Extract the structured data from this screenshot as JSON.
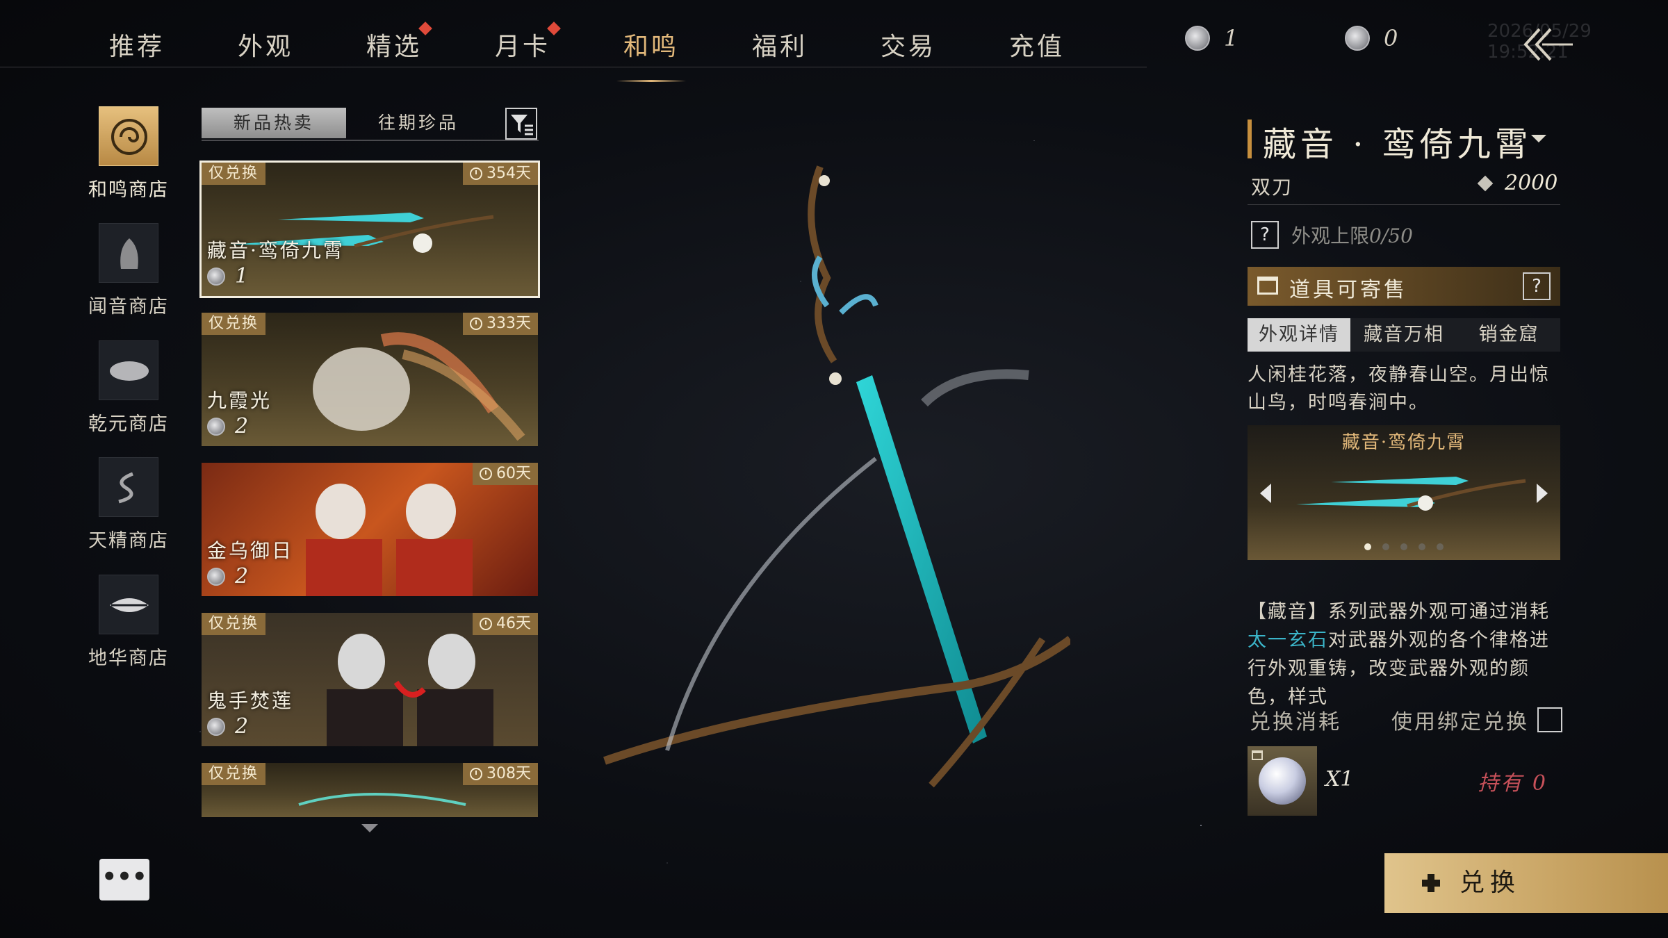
{
  "nav": {
    "tabs": [
      {
        "label": "推荐",
        "dot": false
      },
      {
        "label": "外观",
        "dot": false
      },
      {
        "label": "精选",
        "dot": true
      },
      {
        "label": "月卡",
        "dot": true
      },
      {
        "label": "和鸣",
        "dot": false,
        "active": true
      },
      {
        "label": "福利",
        "dot": false
      },
      {
        "label": "交易",
        "dot": false
      },
      {
        "label": "充值",
        "dot": false
      }
    ],
    "currency_a": "1",
    "currency_b": "0",
    "timestamp": "2026/05/29 19:52:21",
    "back_icon": "double-chevron-left-icon"
  },
  "shops": [
    {
      "label": "和鸣商店",
      "active": true
    },
    {
      "label": "闻音商店",
      "active": false
    },
    {
      "label": "乾元商店",
      "active": false
    },
    {
      "label": "天精商店",
      "active": false
    },
    {
      "label": "地华商店",
      "active": false
    }
  ],
  "list": {
    "subtabs": [
      "新品热卖",
      "往期珍品"
    ],
    "active_subtab": 0,
    "items": [
      {
        "tag": "仅兑换",
        "days": "354天",
        "name": "藏音·鸾倚九霄",
        "price": "1",
        "selected": true
      },
      {
        "tag": "仅兑换",
        "days": "333天",
        "name": "九霞光",
        "price": "2",
        "selected": false
      },
      {
        "tag": "",
        "days": "60天",
        "name": "金乌御日",
        "price": "2",
        "selected": false
      },
      {
        "tag": "仅兑换",
        "days": "46天",
        "name": "鬼手焚莲",
        "price": "2",
        "selected": false
      },
      {
        "tag": "仅兑换",
        "days": "308天",
        "name": "",
        "price": "",
        "selected": false
      }
    ]
  },
  "more_label": "•••",
  "detail": {
    "title": "藏音 · 鸾倚九霄",
    "weapon_type": "双刀",
    "price": "2000",
    "limit_label": "外观上限",
    "limit_value": "0/50",
    "consign_label": "道具可寄售",
    "tabs": [
      "外观详情",
      "藏音万相",
      "销金窟"
    ],
    "active_tab": 0,
    "poem": "人闲桂花落，夜静春山空。月出惊山鸟，时鸣春涧中。",
    "preview_title": "藏音·鸾倚九霄",
    "preview_pages": 5,
    "preview_active": 0,
    "desc_a": "【藏音】系列武器外观可通过消耗",
    "desc_highlight": "太一玄石",
    "desc_b": "对武器外观的各个律格进行外观重铸，改变武器外观的颜色，样式",
    "cost_label": "兑换消耗",
    "bind_label": "使用绑定兑换",
    "item_qty": "X1",
    "owned": "持有 0",
    "redeem_label": "兑换"
  },
  "colors": {
    "accent": "#e2b87a",
    "highlight": "#3bb5c9",
    "warning": "#c8515a"
  }
}
